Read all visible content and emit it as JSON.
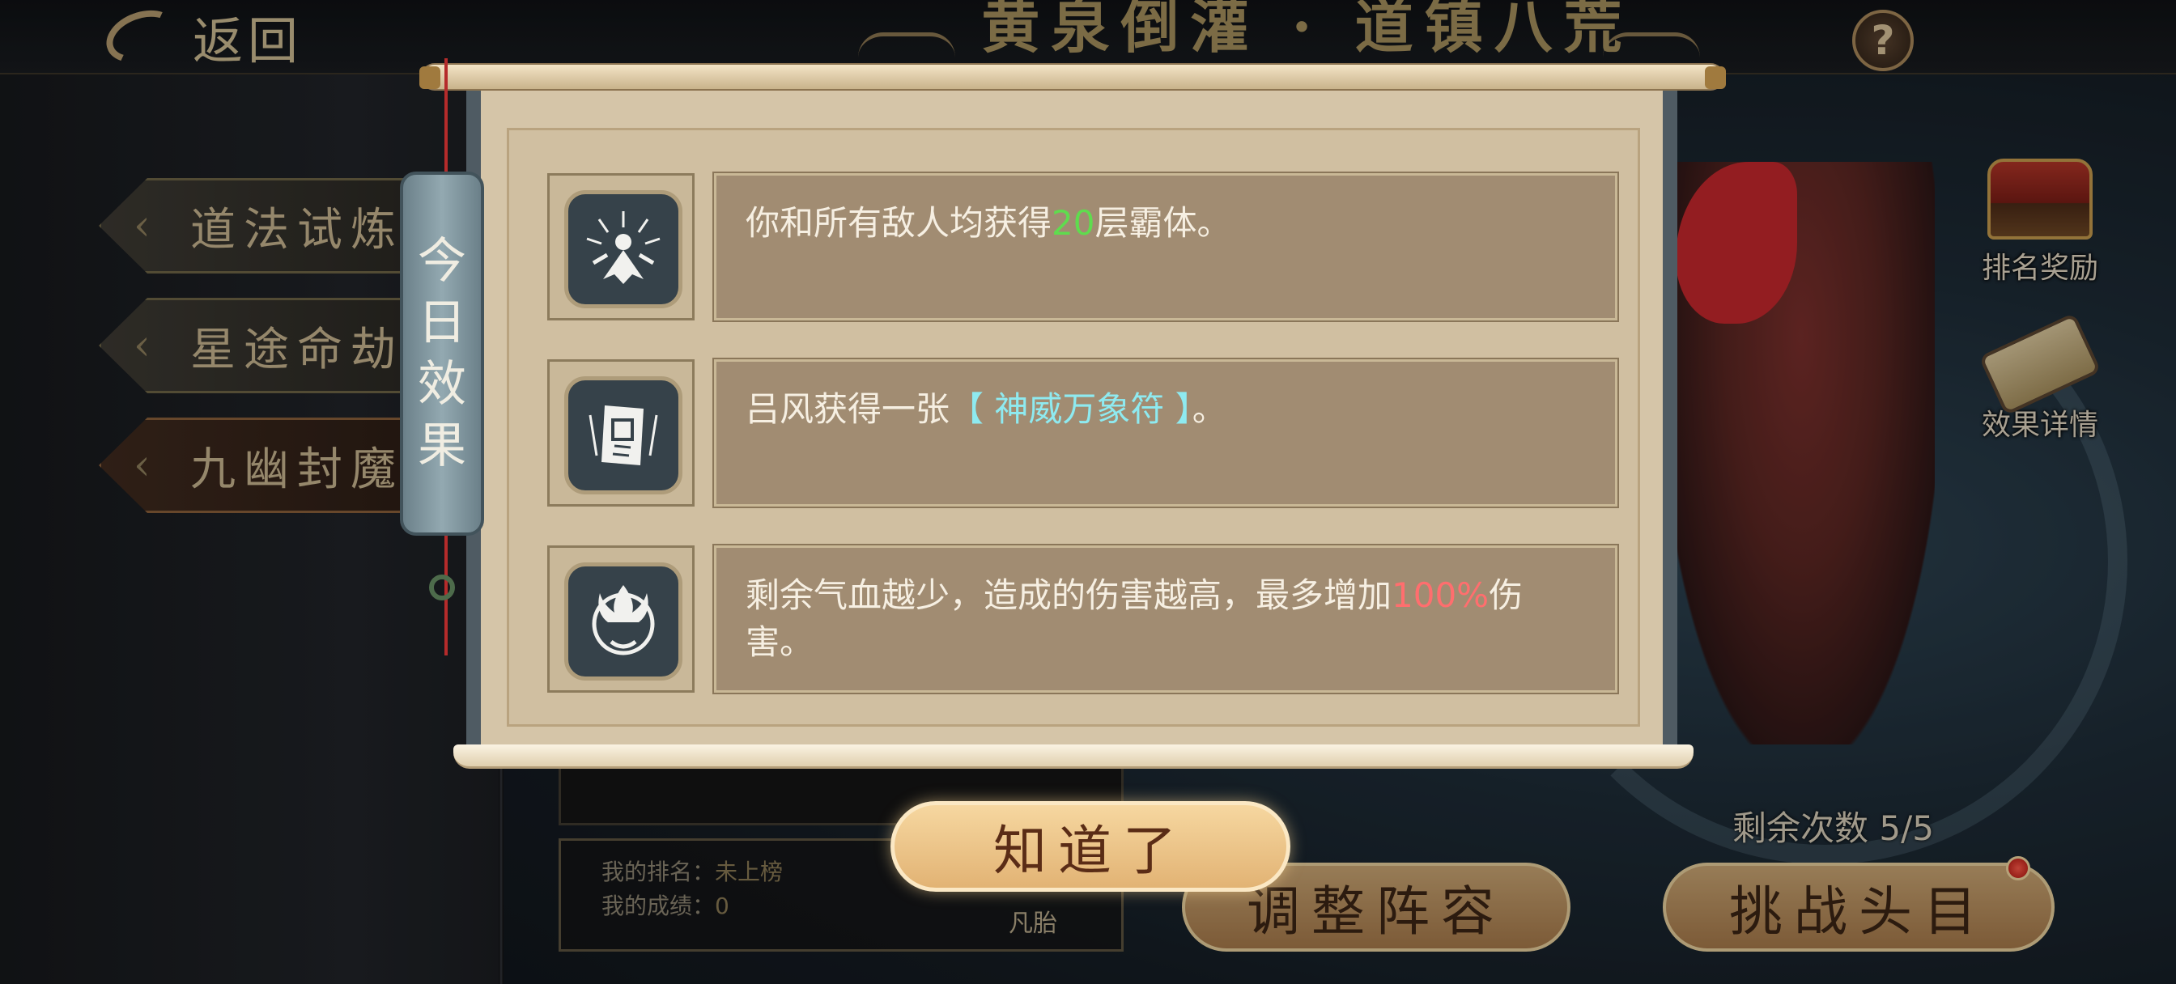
{
  "header": {
    "back_label": "返回",
    "title": "黄泉倒灌 · 道镇八荒"
  },
  "help_symbol": "?",
  "modes": [
    {
      "label": "道法试炼"
    },
    {
      "label": "星途命劫"
    },
    {
      "label": "九幽封魔"
    }
  ],
  "side": {
    "rank_reward": "排名奖励",
    "effect_detail": "效果详情"
  },
  "modal": {
    "tab_label": [
      "今",
      "日",
      "效",
      "果"
    ],
    "effects": [
      {
        "icon": "sorcerer-aura-icon",
        "text_before": "你和所有敌人均获得",
        "highlight": "20",
        "text_after": "层霸体。"
      },
      {
        "icon": "talisman-scroll-icon",
        "text_before": "吕风获得一张",
        "highlight": "【 神威万象符 】",
        "text_after": "。"
      },
      {
        "icon": "demon-face-icon",
        "text_before": "剩余气血越少，造成的伤害越高，最多增加",
        "highlight": "100%",
        "text_after": "伤害。"
      }
    ],
    "confirm_label": "知道了"
  },
  "bottom": {
    "remaining_label": "剩余次数",
    "remaining_value": "5/5",
    "adjust_label": "调整阵容",
    "challenge_label": "挑战头目",
    "my_rank_label": "我的排名：",
    "my_rank_value": "未上榜",
    "my_score_label": "我的成绩：",
    "my_score_value": "0",
    "fan_label": "凡胎"
  }
}
